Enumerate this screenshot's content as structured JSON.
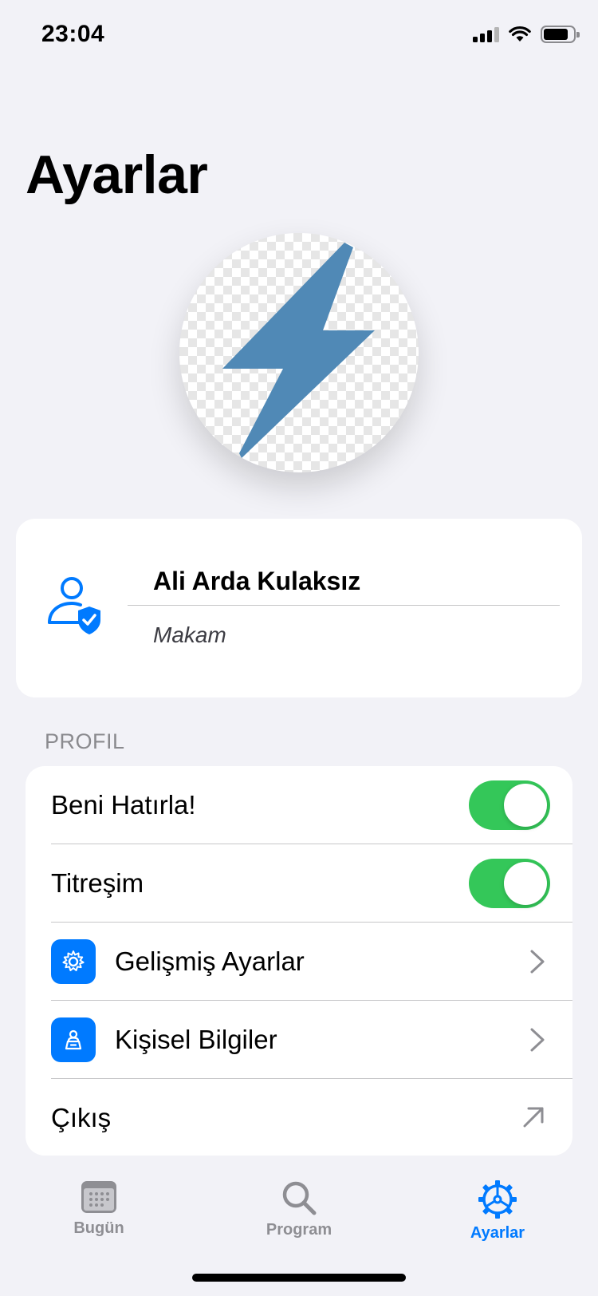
{
  "status_bar": {
    "time": "23:04",
    "icons": [
      "cellular-signal-icon",
      "wifi-icon",
      "battery-icon"
    ]
  },
  "page": {
    "title": "Ayarlar"
  },
  "avatar": {
    "icon": "lightning-bolt-icon",
    "color": "#5089B6"
  },
  "profile": {
    "name": "Ali Arda Kulaksız",
    "title_placeholder": "Makam",
    "icon": "person-shield-icon"
  },
  "settings": {
    "section_header": "PROFIL",
    "rows": [
      {
        "label": "Beni Hatırla!",
        "type": "toggle",
        "on": true
      },
      {
        "label": "Titreşim",
        "type": "toggle",
        "on": true
      },
      {
        "label": "Gelişmiş Ayarlar",
        "type": "link",
        "icon": "gear-icon"
      },
      {
        "label": "Kişisel Bilgiler",
        "type": "link",
        "icon": "person-badge-icon"
      },
      {
        "label": "Çıkış",
        "type": "external",
        "icon": "arrow-up-right-icon"
      }
    ]
  },
  "tab_bar": {
    "tabs": [
      {
        "label": "Bugün",
        "icon": "calendar-icon",
        "active": false
      },
      {
        "label": "Program",
        "icon": "search-icon",
        "active": false
      },
      {
        "label": "Ayarlar",
        "icon": "steering-gear-icon",
        "active": true
      }
    ]
  },
  "colors": {
    "accent": "#007AFF",
    "toggle_on": "#34C759",
    "background": "#F2F2F7",
    "inactive_tab": "#8E8E93"
  }
}
